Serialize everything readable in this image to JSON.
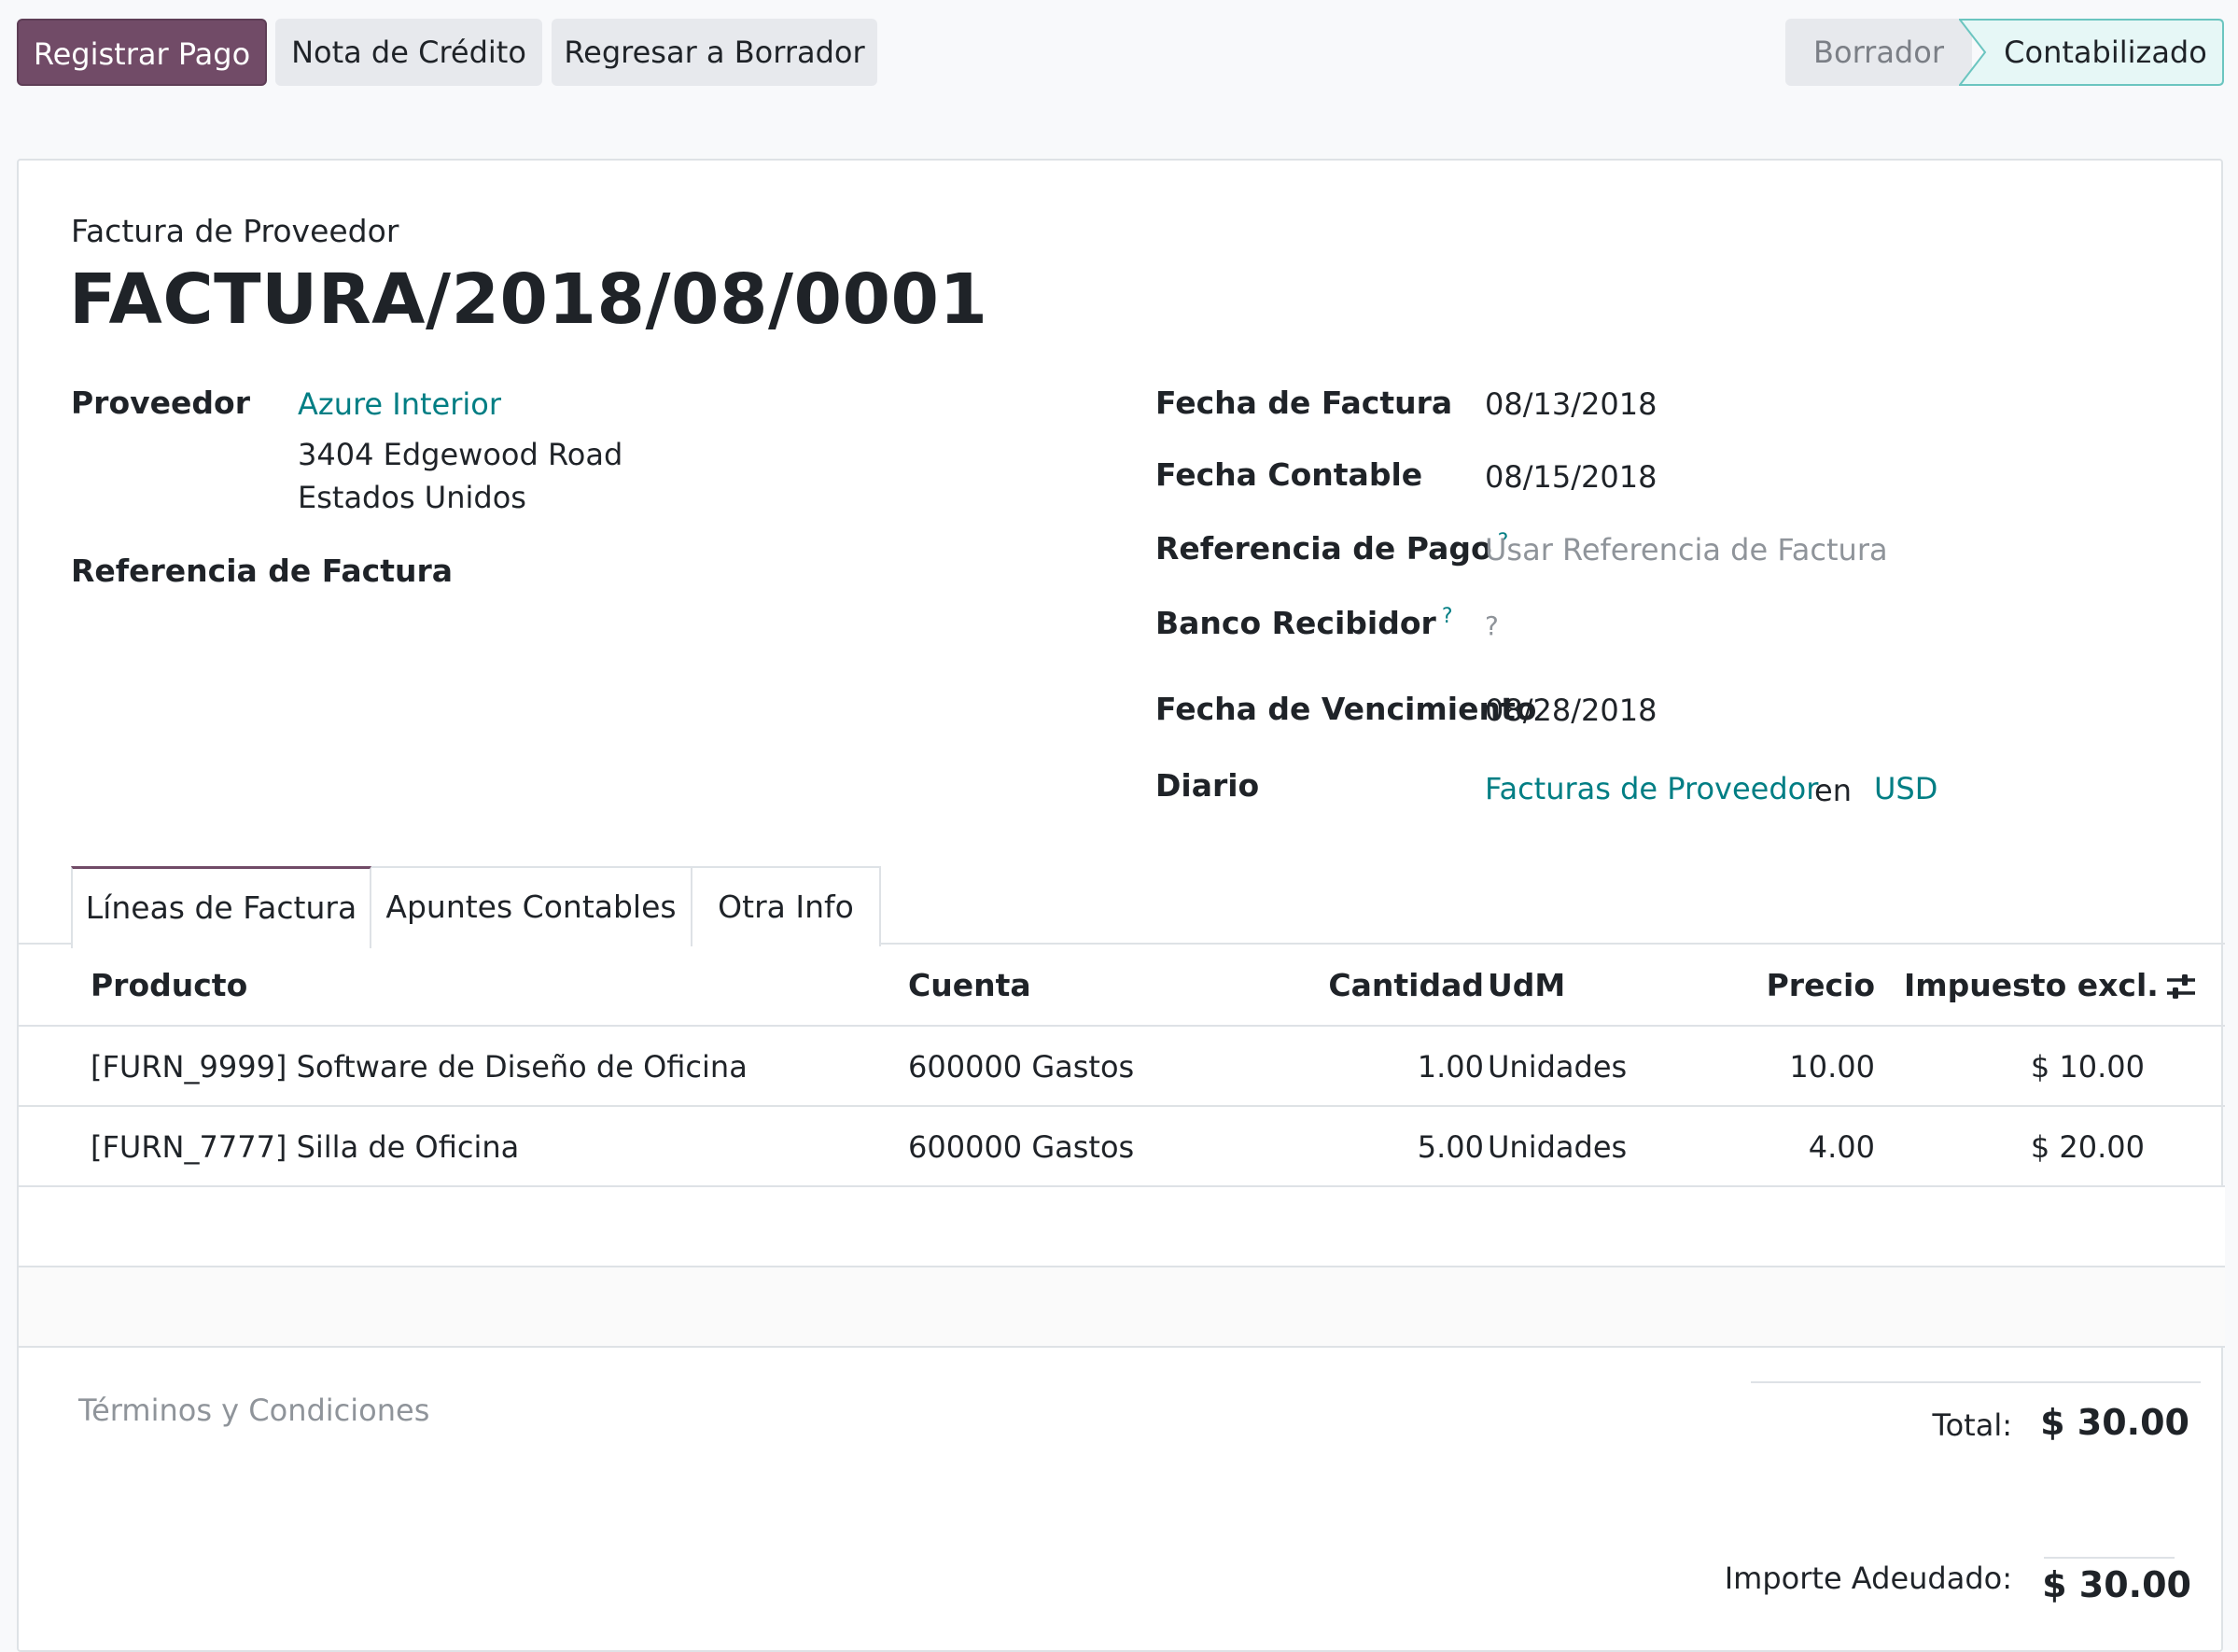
{
  "toolbar": {
    "register_payment": "Registrar Pago",
    "credit_note": "Nota de Crédito",
    "reset_to_draft": "Regresar a Borrador"
  },
  "statusbar": {
    "draft": "Borrador",
    "posted": "Contabilizado"
  },
  "document": {
    "type": "Factura de Proveedor",
    "number": "FACTURA/2018/08/0001"
  },
  "left_fields": {
    "vendor_label": "Proveedor",
    "vendor_name": "Azure Interior",
    "vendor_address_line1": "3404 Edgewood Road",
    "vendor_address_line2": "Estados Unidos",
    "bill_reference_label": "Referencia de Factura"
  },
  "right_fields": {
    "invoice_date_label": "Fecha de Factura",
    "invoice_date": "08/13/2018",
    "accounting_date_label": "Fecha Contable",
    "accounting_date": "08/15/2018",
    "payment_reference_label": "Referencia de Pago",
    "payment_reference_placeholder": "Usar Referencia de Factura",
    "recipient_bank_label": "Banco Recibidor",
    "recipient_bank_value": "?",
    "due_date_label": "Fecha de Vencimiento",
    "due_date": "08/28/2018",
    "journal_label": "Diario",
    "journal": "Facturas de Proveedor",
    "in_word": "en",
    "currency": "USD",
    "help_mark": "?"
  },
  "tabs": [
    "Líneas de Factura",
    "Apuntes Contables",
    "Otra Info"
  ],
  "table": {
    "columns": {
      "product": "Producto",
      "account": "Cuenta",
      "quantity": "Cantidad",
      "uom": "UdM",
      "price": "Precio",
      "tax_excl": "Impuesto excl."
    },
    "rows": [
      {
        "product": "[FURN_9999] Software de Diseño de Oficina",
        "account": "600000 Gastos",
        "quantity": "1.00",
        "uom": "Unidades",
        "price": "10.00",
        "subtotal": "$ 10.00"
      },
      {
        "product": "[FURN_7777] Silla de Oficina",
        "account": "600000 Gastos",
        "quantity": "5.00",
        "uom": "Unidades",
        "price": "4.00",
        "subtotal": "$ 20.00"
      }
    ]
  },
  "footer": {
    "terms_placeholder": "Términos y Condiciones",
    "total_label": "Total:",
    "total_value": "$ 30.00",
    "amount_due_label": "Importe Adeudado:",
    "amount_due_value": "$ 30.00"
  },
  "colors": {
    "primary": "#714b67",
    "link": "#017e84",
    "status_active_bg": "#e6f7f6",
    "status_active_border": "#6bc5c0"
  },
  "icons": {
    "column_settings": "sliders-icon"
  }
}
